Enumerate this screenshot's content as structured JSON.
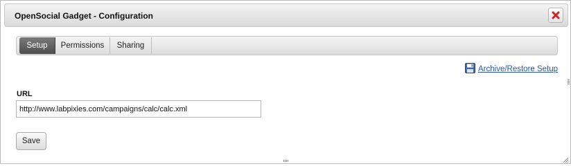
{
  "dialog": {
    "title": "OpenSocial Gadget - Configuration",
    "close_icon": "close-icon",
    "close_color": "#cc2222"
  },
  "tabs": [
    {
      "label": "Setup",
      "active": true
    },
    {
      "label": "Permissions",
      "active": false
    },
    {
      "label": "Sharing",
      "active": false
    }
  ],
  "archive": {
    "label": "Archive/Restore Setup",
    "icon": "floppy-disk-icon"
  },
  "form": {
    "url_label": "URL",
    "url_value": "http://www.labpixies.com/campaigns/calc/calc.xml"
  },
  "actions": {
    "save_label": "Save"
  },
  "colors": {
    "link": "#2a57a8",
    "active_tab": "#5a5a5a"
  }
}
